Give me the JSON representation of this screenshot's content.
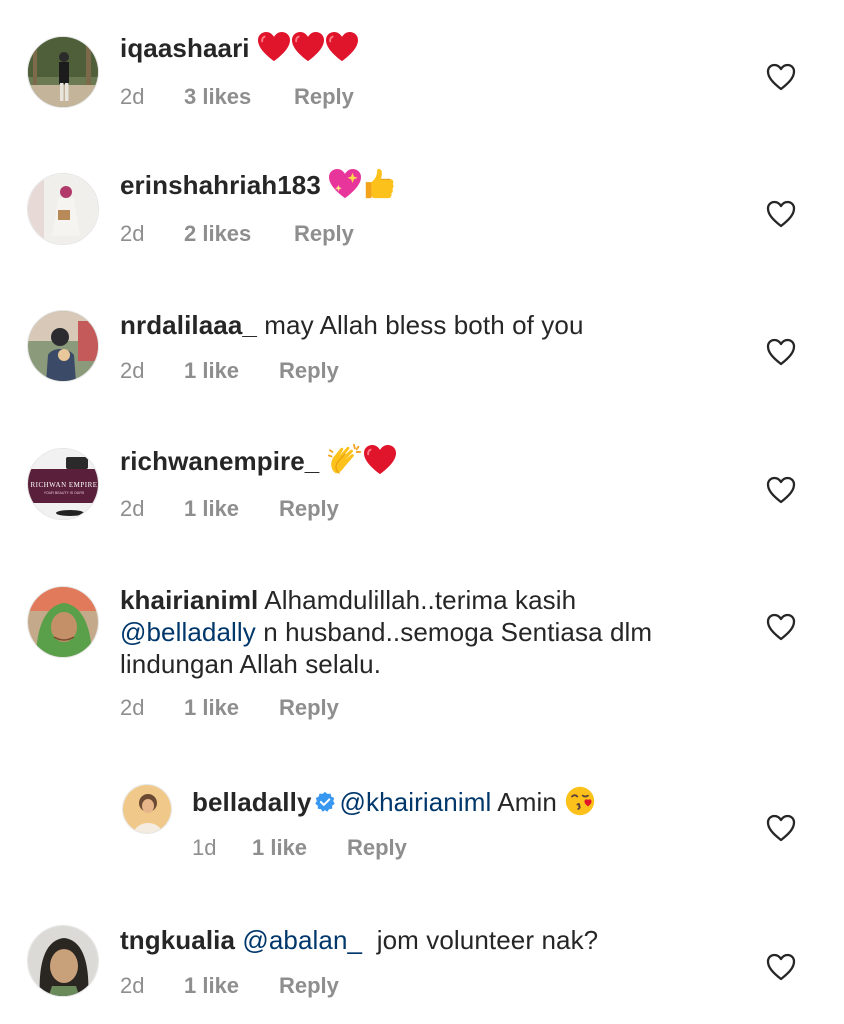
{
  "comments": [
    {
      "username": "iqaashaari",
      "text": "",
      "emojis": [
        "red-heart",
        "red-heart",
        "red-heart"
      ],
      "time": "2d",
      "likes": "3 likes",
      "reply": "Reply"
    },
    {
      "username": "erinshahriah183",
      "text": "",
      "emojis": [
        "sparkling-heart",
        "thumbs-up"
      ],
      "time": "2d",
      "likes": "2 likes",
      "reply": "Reply"
    },
    {
      "username": "nrdalilaaa_",
      "text": "may Allah bless both of you",
      "emojis": [],
      "time": "2d",
      "likes": "1 like",
      "reply": "Reply"
    },
    {
      "username": "richwanempire_",
      "text": "",
      "emojis": [
        "clapping-hands",
        "red-heart"
      ],
      "time": "2d",
      "likes": "1 like",
      "reply": "Reply",
      "avatar_text": "RICHWAN EMPIRE",
      "avatar_subtext": "YOUR BEAUTY IS OURS"
    },
    {
      "username": "khairianiml",
      "text_before": "Alhamdulillah..terima kasih",
      "mention": "@belladally",
      "text_after": "n husband..semoga Sentiasa dlm lindungan Allah selalu.",
      "time": "2d",
      "likes": "1 like",
      "reply": "Reply"
    },
    {
      "username": "belladally",
      "verified": true,
      "mention": "@khairianiml",
      "text": "Amin",
      "emojis": [
        "face-blowing-kiss"
      ],
      "time": "1d",
      "likes": "1 like",
      "reply": "Reply",
      "is_reply": true
    },
    {
      "username": "tngkualia",
      "mention": "@abalan_",
      "text": "jom volunteer nak?",
      "time": "2d",
      "likes": "1 like",
      "reply": "Reply"
    }
  ],
  "colors": {
    "text": "#262626",
    "meta": "#8e8e8e",
    "mention": "#00376b",
    "verified": "#3897f0",
    "heart_outline": "#262626"
  }
}
